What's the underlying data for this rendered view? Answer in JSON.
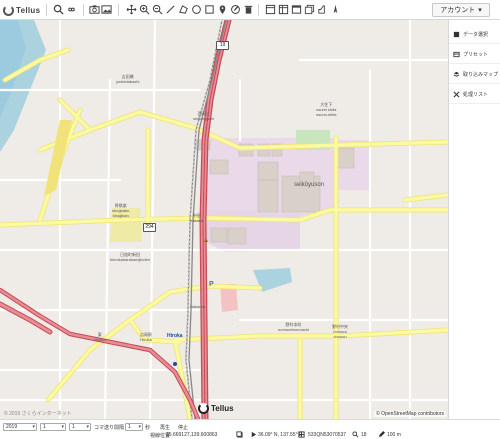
{
  "app": {
    "logo_text": "Tellus"
  },
  "toolbar": {
    "icons": [
      "search-icon",
      "infinity-icon",
      "camera-icon",
      "image-icon",
      "move-icon",
      "zoom-in-icon",
      "zoom-out-icon",
      "line-icon",
      "polygon-icon",
      "circle-icon",
      "square-icon",
      "pin-icon",
      "edit-icon",
      "delete-icon",
      "panel-icon",
      "layout-icon",
      "window-icon",
      "layers-icon",
      "share-icon",
      "compass-icon"
    ],
    "account_label": "アカウント"
  },
  "sidepanel": {
    "items": [
      {
        "label": "データ選択",
        "icon": "database-icon"
      },
      {
        "label": "プリセット",
        "icon": "preset-icon"
      },
      {
        "label": "取り込みマップ",
        "icon": "layers-icon"
      },
      {
        "label": "処理リスト",
        "icon": "tools-icon"
      }
    ]
  },
  "map": {
    "labels": {
      "yoshidabashi": [
        "吉田橋",
        "yoshidabashi"
      ],
      "seikoe": [
        "西高江",
        "seikoeguchi"
      ],
      "yoshida_kita": [
        "吉田北",
        "yoshida-kita"
      ],
      "nakada": [
        "中田",
        "nakada"
      ],
      "osumi_shita": [
        "大住下",
        "osumi shita",
        "osumi-shita"
      ],
      "seikoyuson": "seikōyuson",
      "shogiraku": [
        "将棋楽",
        "shogiraku",
        "shogikan"
      ],
      "himoka_jinden": [
        "日詰町新田",
        "himokaharakamijinden"
      ],
      "nakaura": "Nakaura",
      "hiroka_stn": [
        "広岡駅",
        "Hiroka"
      ],
      "higashi": [
        "東",
        "Hiroka"
      ],
      "hiroka": "Hiroka",
      "nomura_honmachi": [
        "野村本町",
        "nomurahonmachi"
      ],
      "nomura_chuo": [
        "野村中央",
        "nomura",
        "chuuou"
      ]
    },
    "route_shields": [
      "19",
      "294"
    ],
    "parking_label": "P",
    "watermark": "© 2019 さくらインターネット",
    "copyright": "© OpenStreetMap contributors",
    "map_logo_text": "Tellus"
  },
  "bottombar": {
    "year_value": "2019",
    "month_value": "1",
    "day_value": "1",
    "frame_label": "コマ送り間隔",
    "step_value": "1",
    "step_unit": "秒",
    "play_label": "再生",
    "stop_label": "停止",
    "coord_label": "視線位置",
    "coord_value": "35.669127,139.600863",
    "latlon_value": "36.09° N, 137.55° E",
    "mesh_value": "533QN53070537",
    "zoom_value": "18",
    "scale_value": "100 m"
  },
  "colors": {
    "railway": "#c74a56",
    "primary_road": "#f7f5a5",
    "major_road": "#fafaa0",
    "residential": "#e8e2de",
    "landuse_commercial": "#e9d9e9",
    "water": "#aad3df",
    "green": "#c8e6bd"
  }
}
